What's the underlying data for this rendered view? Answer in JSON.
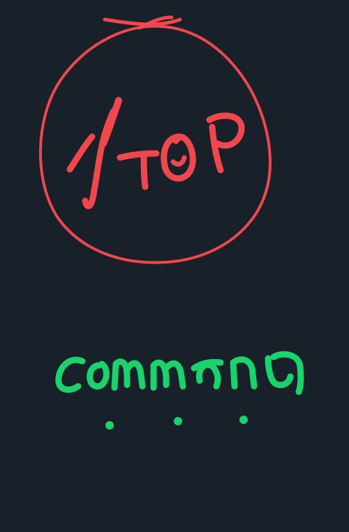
{
  "handwriting": {
    "top_word": "STOP",
    "bottom_word": "command",
    "ellipsis": "..."
  },
  "colors": {
    "background": "#18202a",
    "top_ink": "#f0474d",
    "bottom_ink": "#19d36d"
  }
}
